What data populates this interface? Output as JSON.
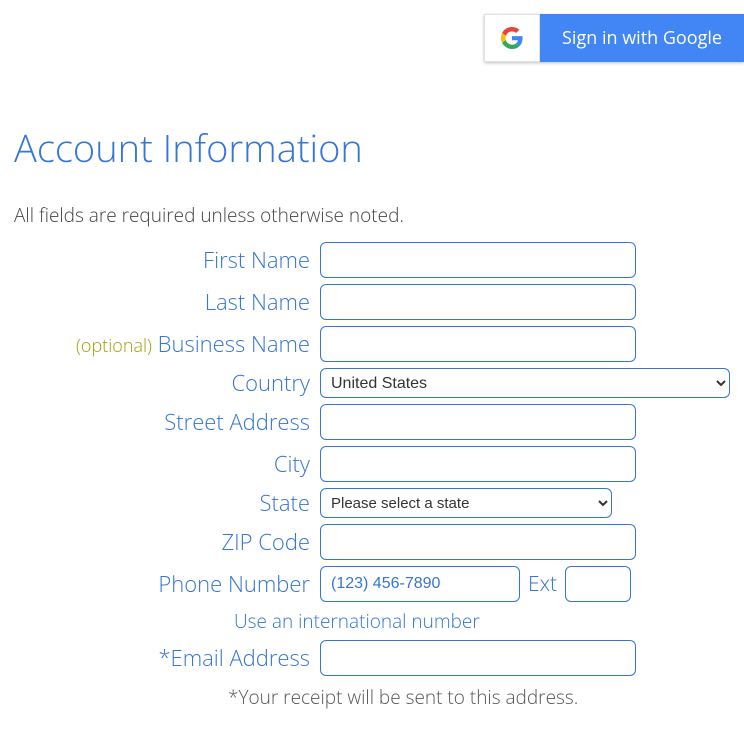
{
  "google_button": {
    "label": "Sign in with Google"
  },
  "title": "Account Information",
  "subhead": "All fields are required unless otherwise noted.",
  "labels": {
    "first_name": "First Name",
    "last_name": "Last Name",
    "optional": "(optional)",
    "business_name": "Business Name",
    "country": "Country",
    "street_address": "Street Address",
    "city": "City",
    "state": "State",
    "zip": "ZIP Code",
    "phone": "Phone Number",
    "ext": "Ext",
    "email": "*Email Address"
  },
  "country_selected": "United States",
  "state_placeholder": "Please select a state",
  "phone_placeholder": "(123) 456-7890",
  "intl_link": "Use an international number",
  "receipt_note": "*Your receipt will be sent to this address."
}
